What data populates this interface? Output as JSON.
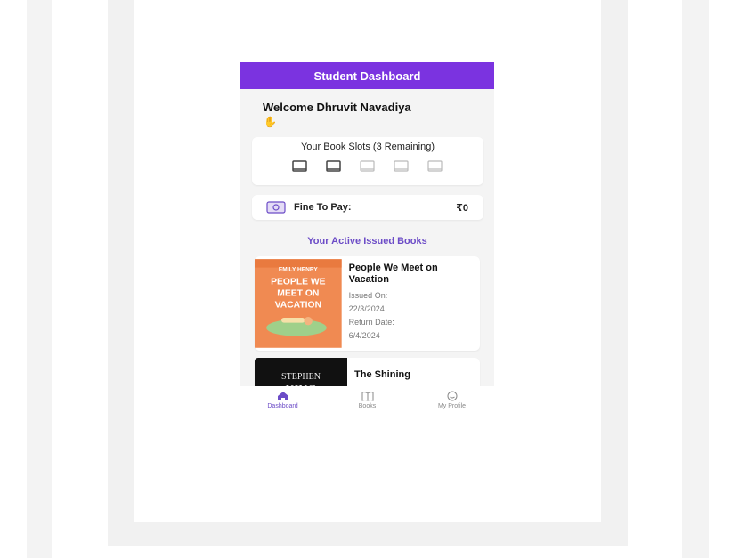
{
  "app": {
    "title": "Student Dashboard",
    "welcome": "Welcome Dhruvit Navadiya",
    "welcome_emoji_icon": "waving-hand-icon"
  },
  "slots": {
    "title": "Your Book Slots (3 Remaining)",
    "total": 5,
    "used": 2,
    "remaining": 3
  },
  "fine": {
    "label": "Fine To Pay:",
    "amount": "₹0",
    "icon": "money-icon"
  },
  "issued": {
    "section_title": "Your Active Issued Books",
    "books": [
      {
        "title": "People We Meet on Vacation",
        "issued_label": "Issued On:",
        "issued_date": "22/3/2024",
        "return_label": "Return Date:",
        "return_date": "6/4/2024",
        "cover": {
          "author": "EMILY HENRY",
          "title": "PEOPLE WE MEET ON VACATION",
          "bg_color": "#f08a52"
        }
      },
      {
        "title": "The Shining",
        "cover": {
          "author": "STEPHEN KING",
          "bg_color": "#111111"
        }
      }
    ]
  },
  "tabs": [
    {
      "label": "Dashboard",
      "icon": "home-icon",
      "active": true
    },
    {
      "label": "Books",
      "icon": "book-open-icon",
      "active": false
    },
    {
      "label": "My Profile",
      "icon": "profile-icon",
      "active": false
    }
  ],
  "colors": {
    "primary": "#7b33e0",
    "section_title": "#6c4cc7",
    "screen_bg": "#f4f4f4"
  }
}
